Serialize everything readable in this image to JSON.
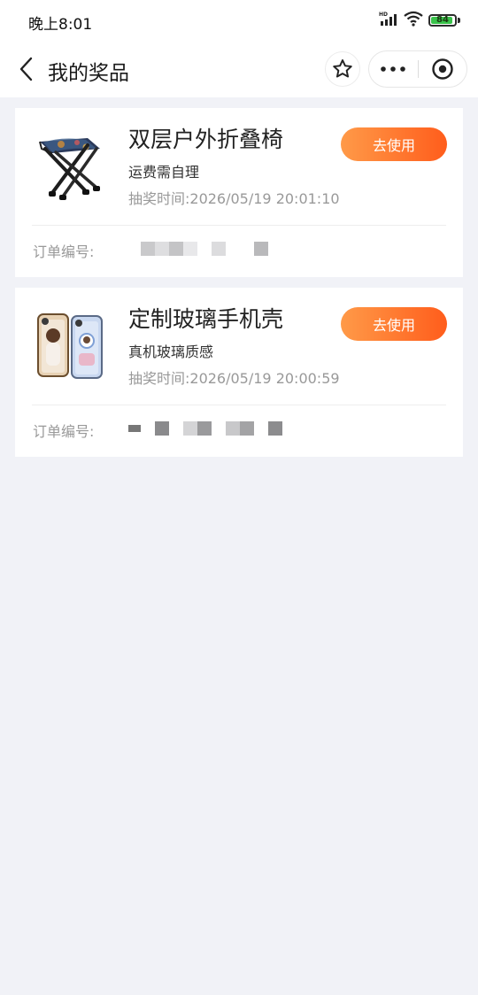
{
  "status_bar": {
    "time": "晚上8:01",
    "battery": "84",
    "signal_label": "HD"
  },
  "nav": {
    "title": "我的奖品"
  },
  "prizes": [
    {
      "thumb_icon": "folding-stool-image",
      "title": "双层户外折叠椅",
      "desc": "运费需自理",
      "time": "抽奖时间:2026/05/19 20:01:10",
      "button": "去使用",
      "order_label": "订单编号:"
    },
    {
      "thumb_icon": "phone-case-image",
      "title": "定制玻璃手机壳",
      "desc": "真机玻璃质感",
      "time": "抽奖时间:2026/05/19 20:00:59",
      "button": "去使用",
      "order_label": "订单编号:"
    }
  ],
  "colors": {
    "accent_start": "#ff9a48",
    "accent_end": "#ff5d1c",
    "page_bg": "#f1f2f7"
  }
}
